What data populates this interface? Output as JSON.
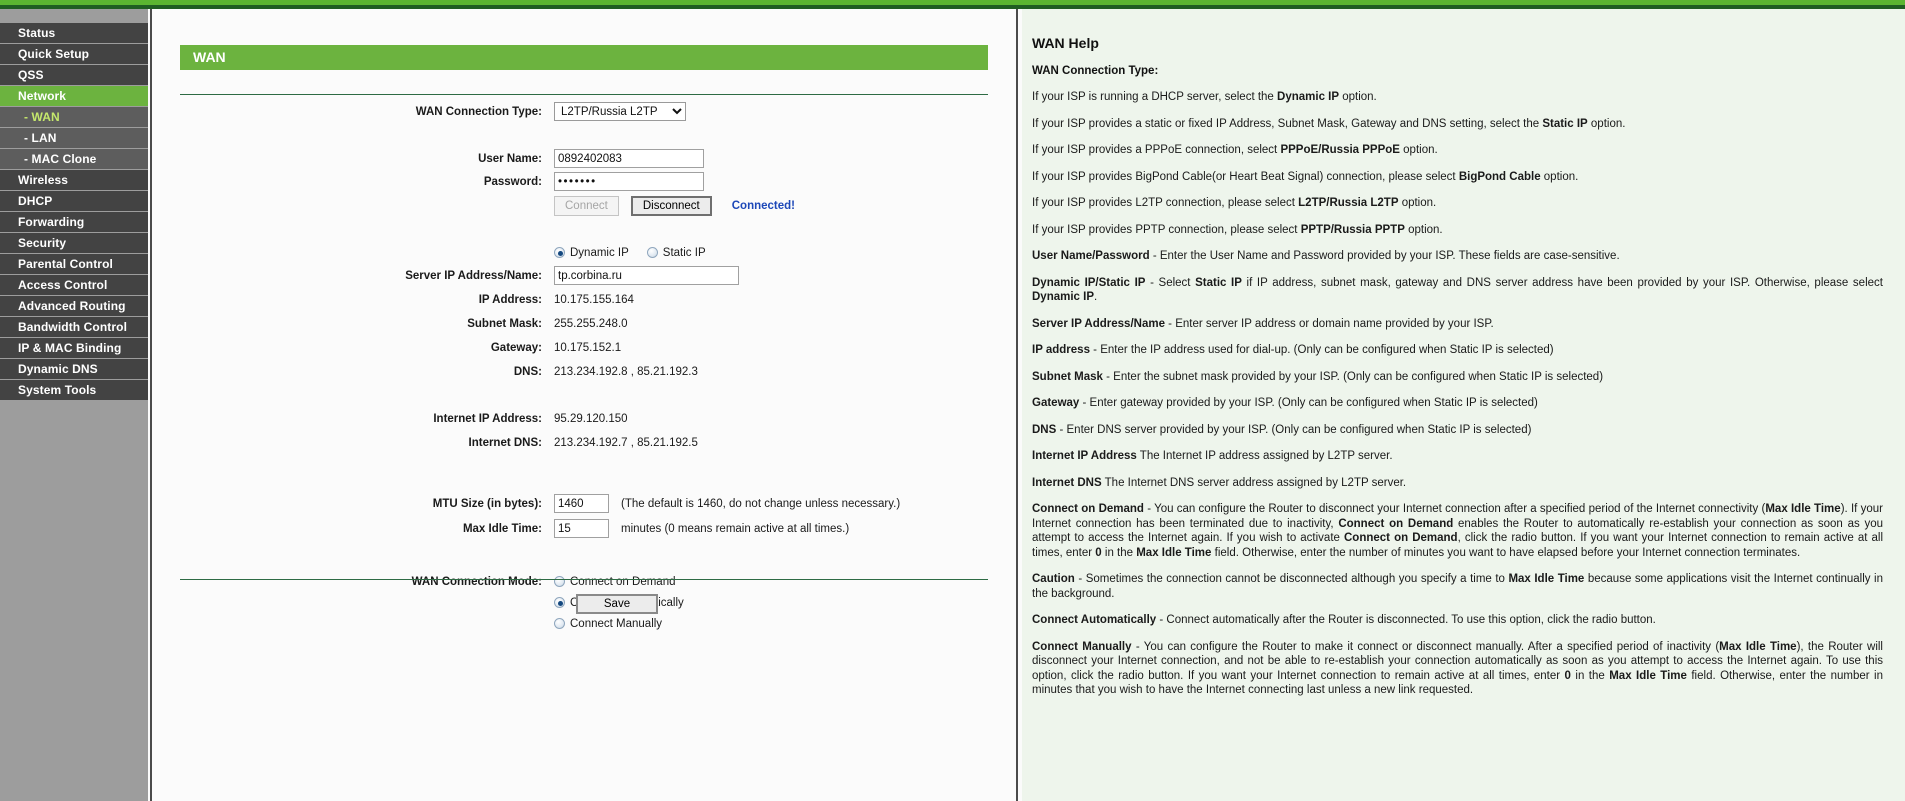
{
  "sidebar": {
    "items": [
      {
        "label": "Status",
        "type": "top",
        "state": "normal"
      },
      {
        "label": "Quick Setup",
        "type": "top",
        "state": "normal"
      },
      {
        "label": "QSS",
        "type": "top",
        "state": "normal"
      },
      {
        "label": "Network",
        "type": "top",
        "state": "active"
      },
      {
        "label": "- WAN",
        "type": "sub",
        "state": "selected"
      },
      {
        "label": "- LAN",
        "type": "sub",
        "state": "normal"
      },
      {
        "label": "- MAC Clone",
        "type": "sub",
        "state": "normal"
      },
      {
        "label": "Wireless",
        "type": "top",
        "state": "normal"
      },
      {
        "label": "DHCP",
        "type": "top",
        "state": "normal"
      },
      {
        "label": "Forwarding",
        "type": "top",
        "state": "normal"
      },
      {
        "label": "Security",
        "type": "top",
        "state": "normal"
      },
      {
        "label": "Parental Control",
        "type": "top",
        "state": "normal"
      },
      {
        "label": "Access Control",
        "type": "top",
        "state": "normal"
      },
      {
        "label": "Advanced Routing",
        "type": "top",
        "state": "normal"
      },
      {
        "label": "Bandwidth Control",
        "type": "top",
        "state": "normal"
      },
      {
        "label": "IP & MAC Binding",
        "type": "top",
        "state": "normal"
      },
      {
        "label": "Dynamic DNS",
        "type": "top",
        "state": "normal"
      },
      {
        "label": "System Tools",
        "type": "top",
        "state": "normal"
      }
    ]
  },
  "page": {
    "banner_title": "WAN"
  },
  "form": {
    "wan_connection_type_label": "WAN Connection Type:",
    "wan_connection_type_value": "L2TP/Russia L2TP",
    "wan_connection_type_options": [
      "Dynamic IP",
      "Static IP",
      "PPPoE/Russia PPPoE",
      "BigPond Cable",
      "L2TP/Russia L2TP",
      "PPTP/Russia PPTP"
    ],
    "user_name_label": "User Name:",
    "user_name_value": "0892402083",
    "password_label": "Password:",
    "password_value": "•••••••",
    "connect_button": "Connect",
    "disconnect_button": "Disconnect",
    "connection_status": "Connected!",
    "ip_mode_dynamic": "Dynamic IP",
    "ip_mode_static": "Static IP",
    "ip_mode_selected": "Dynamic IP",
    "server_ip_label": "Server IP Address/Name:",
    "server_ip_value": "tp.corbina.ru",
    "ip_address_label": "IP Address:",
    "ip_address_value": "10.175.155.164",
    "subnet_mask_label": "Subnet Mask:",
    "subnet_mask_value": "255.255.248.0",
    "gateway_label": "Gateway:",
    "gateway_value": "10.175.152.1",
    "dns_label": "DNS:",
    "dns_value": "213.234.192.8 , 85.21.192.3",
    "internet_ip_label": "Internet IP Address:",
    "internet_ip_value": "95.29.120.150",
    "internet_dns_label": "Internet DNS:",
    "internet_dns_value": "213.234.192.7 , 85.21.192.5",
    "mtu_label": "MTU Size (in bytes):",
    "mtu_value": "1460",
    "mtu_hint": "(The default is 1460, do not change unless necessary.)",
    "max_idle_label": "Max Idle Time:",
    "max_idle_value": "15",
    "max_idle_hint": "minutes (0 means remain active at all times.)",
    "wan_mode_label": "WAN Connection Mode:",
    "wan_mode_options": [
      "Connect on Demand",
      "Connect Automatically",
      "Connect Manually"
    ],
    "wan_mode_selected": "Connect Automatically",
    "save_button": "Save"
  },
  "help": {
    "title": "WAN Help",
    "subtitle": "WAN Connection Type:",
    "paragraphs": [
      "If your ISP is running a DHCP server, select the <b>Dynamic IP</b> option.",
      "If your ISP provides a static or fixed IP Address, Subnet Mask, Gateway and DNS setting, select the <b>Static IP</b> option.",
      "If your ISP provides a PPPoE connection, select <b>PPPoE/Russia PPPoE</b> option.",
      "If your ISP provides BigPond Cable(or Heart Beat Signal) connection, please select <b>BigPond Cable</b> option.",
      "If your ISP provides L2TP connection, please select <b>L2TP/Russia L2TP</b> option.",
      "If your ISP provides PPTP connection, please select <b>PPTP/Russia PPTP</b> option.",
      "<b>User Name/Password</b> - Enter the User Name and Password provided by your ISP. These fields are case-sensitive.",
      "<b>Dynamic IP/Static IP</b> - Select <b>Static IP</b> if IP address, subnet mask, gateway and DNS server address have been provided by your ISP. Otherwise, please select <b>Dynamic IP</b>.",
      "<b>Server IP Address/Name</b> - Enter server IP address or domain name provided by your ISP.",
      "<b>IP address</b> - Enter the IP address used for dial-up. (Only can be configured when Static IP is selected)",
      "<b>Subnet Mask</b> - Enter the subnet mask provided by your ISP. (Only can be configured when Static IP is selected)",
      "<b>Gateway</b> - Enter gateway provided by your ISP. (Only can be configured when Static IP is selected)",
      "<b>DNS</b> - Enter DNS server provided by your ISP. (Only can be configured when Static IP is selected)",
      "<b>Internet IP Address</b> The Internet IP address assigned by L2TP server.",
      "<b>Internet DNS</b> The Internet DNS server address assigned by L2TP server.",
      "<b>Connect on Demand</b> - You can configure the Router to disconnect your Internet connection after a specified period of the Internet connectivity (<b>Max Idle Time</b>). If your Internet connection has been terminated due to inactivity, <b>Connect on Demand</b> enables the Router to automatically re-establish your connection as soon as you attempt to access the Internet again. If you wish to activate <b>Connect on Demand</b>, click the radio button. If you want your Internet connection to remain active at all times, enter <b>0</b> in the <b>Max Idle Time</b> field. Otherwise, enter the number of minutes you want to have elapsed before your Internet connection terminates.",
      "<b>Caution</b> - Sometimes the connection cannot be disconnected although you specify a time to <b>Max Idle Time</b> because some applications visit the Internet continually in the background.",
      "<b>Connect Automatically</b> - Connect automatically after the Router is disconnected. To use this option, click the radio button.",
      "<b>Connect Manually</b> - You can configure the Router to make it connect or disconnect manually. After a specified period of inactivity (<b>Max Idle Time</b>), the Router will disconnect your Internet connection, and not be able to re-establish your connection automatically as soon as you attempt to access the Internet again. To use this option, click the radio button. If you want your Internet connection to remain active at all times, enter <b>0</b> in the <b>Max Idle Time</b> field. Otherwise, enter the number in minutes that you wish to have the Internet connecting last unless a new link requested."
    ]
  },
  "colors": {
    "accent_green": "#6cb33f",
    "dark_green": "#1f5d22",
    "sidebar_bg": "#9d9d9d",
    "menu_bg": "#434343",
    "help_bg": "#eef5ec",
    "status_blue": "#1d48b8"
  }
}
